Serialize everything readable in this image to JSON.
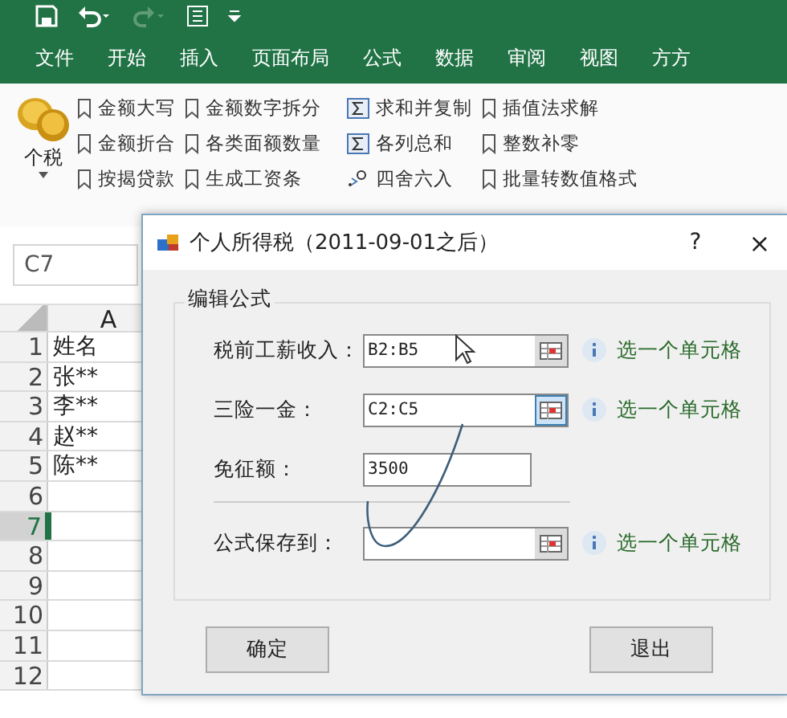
{
  "tabs": [
    {
      "label": "文件"
    },
    {
      "label": "开始"
    },
    {
      "label": "插入"
    },
    {
      "label": "页面布局"
    },
    {
      "label": "公式"
    },
    {
      "label": "数据"
    },
    {
      "label": "审阅"
    },
    {
      "label": "视图"
    },
    {
      "label": "方方"
    }
  ],
  "ribbon": {
    "main_button": "个税",
    "columns": [
      [
        {
          "kind": "bookmark",
          "label": "金额大写"
        },
        {
          "kind": "bookmark",
          "label": "金额折合"
        },
        {
          "kind": "bookmark",
          "label": "按揭贷款"
        }
      ],
      [
        {
          "kind": "bookmark",
          "label": "金额数字拆分"
        },
        {
          "kind": "bookmark",
          "label": "各类面额数量"
        },
        {
          "kind": "bookmark",
          "label": "生成工资条"
        }
      ],
      [
        {
          "kind": "sigma",
          "label": "求和并复制"
        },
        {
          "kind": "sigma",
          "label": "各列总和"
        },
        {
          "kind": "decimal",
          "label": "四舍六入"
        }
      ],
      [
        {
          "kind": "bookmark",
          "label": "插值法求解"
        },
        {
          "kind": "bookmark",
          "label": "整数补零"
        },
        {
          "kind": "bookmark",
          "label": "批量转数值格式"
        }
      ]
    ]
  },
  "name_box": "C7",
  "sheet": {
    "column": "A",
    "rows": [
      {
        "number": "1",
        "value": "姓名",
        "selected": false
      },
      {
        "number": "2",
        "value": "张**",
        "selected": false
      },
      {
        "number": "3",
        "value": "李**",
        "selected": false
      },
      {
        "number": "4",
        "value": "赵**",
        "selected": false
      },
      {
        "number": "5",
        "value": "陈**",
        "selected": false
      },
      {
        "number": "6",
        "selected": false
      },
      {
        "number": "7",
        "selected": true
      },
      {
        "number": "8",
        "selected": false
      },
      {
        "number": "9",
        "selected": false
      },
      {
        "number": "10",
        "selected": false
      },
      {
        "number": "11",
        "selected": false
      },
      {
        "number": "12",
        "selected": false
      }
    ]
  },
  "dialog": {
    "title": "个人所得税（2011-09-01之后）",
    "help": "?",
    "close": "×",
    "group": "编辑公式",
    "fields": [
      {
        "label": "税前工薪收入：",
        "value": "B2:B5",
        "picker": true,
        "focused": false,
        "hint": "选一个单元格"
      },
      {
        "label": "三险一金：",
        "value": "C2:C5",
        "picker": true,
        "focused": true,
        "hint": "选一个单元格"
      },
      {
        "label": "免征额：",
        "value": "3500",
        "picker": false
      },
      {
        "kind": "divider"
      },
      {
        "label": "公式保存到：",
        "picker": true,
        "focused": false,
        "hint": "选一个单元格"
      }
    ],
    "buttons": [
      "确定",
      "退出"
    ]
  }
}
